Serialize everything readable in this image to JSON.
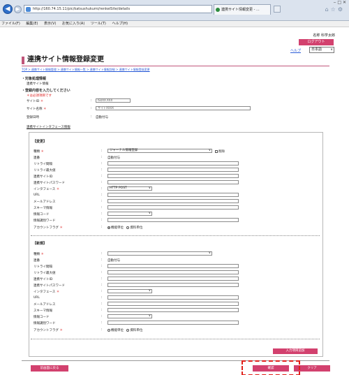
{
  "browser": {
    "url": "http://160.74.15.11/pic/katsushukumi/renkeiSite/details",
    "tab_title": "連携サイト情報変更 - ...",
    "addr_tools": "ρ ▾ C",
    "menu": [
      "ファイル(F)",
      "編集(E)",
      "表示(V)",
      "お気に入り(A)",
      "ツール(T)",
      "ヘルプ(H)"
    ]
  },
  "header": {
    "user_name": "名称 科学太郎",
    "logout_label": "ログアウト",
    "help_label": "ヘルプ",
    "language": "日本語"
  },
  "page": {
    "title": "連携サイト情報登録変更",
    "breadcrumb": "TOP > 連携サイト情報管理 > 連携サイト情報一覧 > 連携サイト情報詳細 > 連携サイト情報登録変更",
    "section_target": "・対象処理情報",
    "section_target_sub": "連携サイト情報",
    "section_input": "・登録内容を入力してください",
    "required_note": "＊は必須項目です",
    "site_id_label": "サイトID",
    "site_id_value": "ISI/XX.XXX",
    "site_name_label": "サイト名称",
    "site_name_value": "サイトXXXX",
    "created_label": "登録日時",
    "created_value": "自動付与",
    "interface_info_title": "連携サイトインタフェース情報",
    "req_mark": "＊",
    "colon": ":"
  },
  "change_panel": {
    "title": "【変更】",
    "kind_label": "種類",
    "kind_value": "ジャーナル情報登録",
    "delete_label": "削除",
    "seq_label": "連番",
    "seq_value": "自動付与",
    "retry_interval_label": "リトライ間隔",
    "retry_max_label": "リトライ最大値",
    "site_id_label": "連携サイトID",
    "password_label": "連携サイトパスワード",
    "interface_label": "インタフェース",
    "interface_value": "HTTP POST",
    "url_label": "URL",
    "mail_label": "メールアドレス",
    "schema_label": "スキーマ情報",
    "info_code_label": "情報コード",
    "keyword_label": "情報識別ワード",
    "account_flag_label": "アカウントフラグ",
    "option_org": "機能単位",
    "option_data": "資料単位"
  },
  "new_panel": {
    "title": "【新規】",
    "kind_label": "種類",
    "seq_label": "連番",
    "seq_value": "自動付与",
    "retry_interval_label": "リトライ間隔",
    "retry_max_label": "リトライ最大値",
    "site_id_label": "連携サイトID",
    "password_label": "連携サイトパスワード",
    "interface_label": "インタフェース",
    "url_label": "URL",
    "mail_label": "メールアドレス",
    "schema_label": "スキーマ情報",
    "info_code_label": "情報コード",
    "keyword_label": "情報識別ワード",
    "account_flag_label": "アカウントフラグ",
    "option_org": "機能単位",
    "option_data": "資料単位"
  },
  "actions": {
    "add_label": "入力項目追加",
    "back_label": "前画面に戻る",
    "confirm_label": "確認",
    "clear_label": "クリア"
  },
  "colors": {
    "accent": "#d2416e",
    "highlight": "#e0201a"
  }
}
